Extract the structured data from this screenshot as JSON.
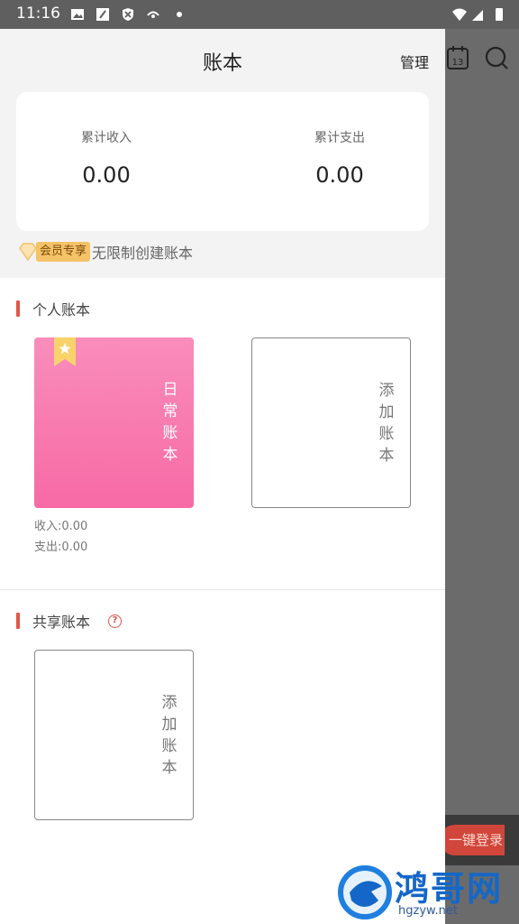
{
  "status_bar": {
    "time": "11:16"
  },
  "drawer": {
    "title": "账本",
    "manage_label": "管理",
    "summary": {
      "income_label": "累计收入",
      "income_value": "0.00",
      "expense_label": "累计支出",
      "expense_value": "0.00"
    },
    "vip": {
      "badge": "会员专享",
      "text": "无限制创建账本"
    },
    "personal": {
      "title": "个人账本",
      "books": [
        {
          "name": "日常账本",
          "income": "收入:0.00",
          "expense": "支出:0.00"
        }
      ],
      "add_label": "添加账本"
    },
    "shared": {
      "title": "共享账本",
      "help_glyph": "?",
      "add_label": "添加账本"
    }
  },
  "background": {
    "login_button": "一键登录"
  },
  "watermark": {
    "brand": "鸿哥网",
    "url": "hgzyw.net"
  },
  "colors": {
    "accent": "#e0584a",
    "book_pink": "#f76aa5",
    "vip_gold": "#f4c267"
  }
}
